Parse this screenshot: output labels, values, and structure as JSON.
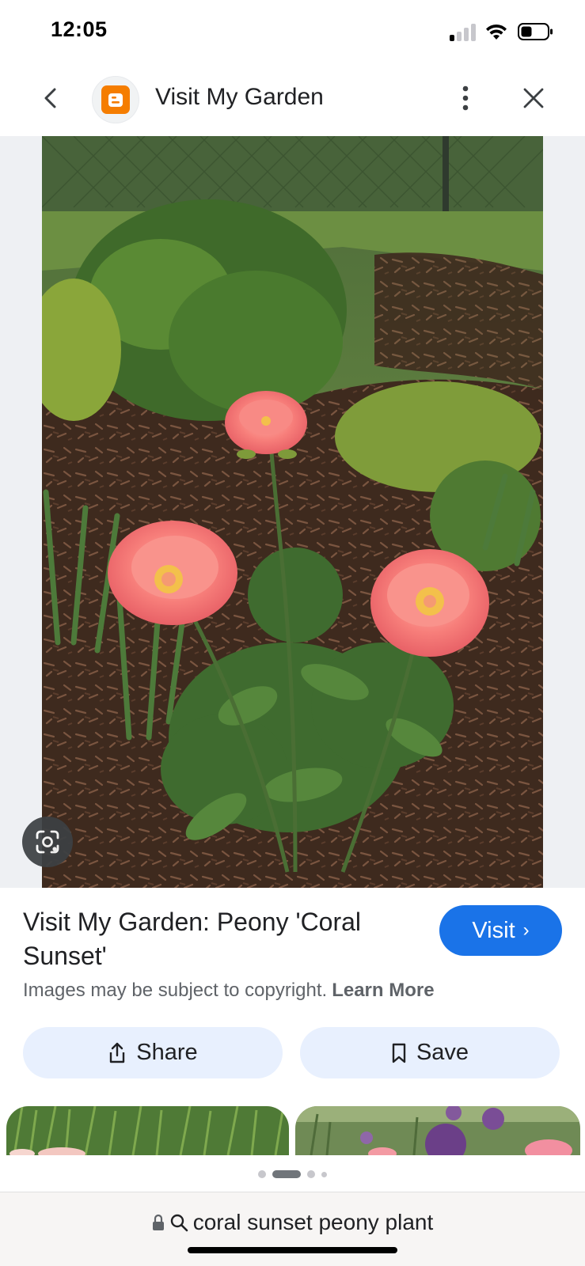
{
  "status_bar": {
    "time": "12:05",
    "icons": [
      "cellular-signal-icon",
      "wifi-icon",
      "battery-icon"
    ]
  },
  "header": {
    "site_logo_icon": "blogger-icon",
    "title": "Visit My Garden",
    "back_icon": "chevron-left-icon",
    "more_icon": "more-vertical-icon",
    "close_icon": "close-icon"
  },
  "image": {
    "lens_icon": "google-lens-icon"
  },
  "info": {
    "title": "Visit My Garden: Peony 'Coral Sunset'",
    "visit_label": "Visit",
    "visit_icon": "chevron-right-icon",
    "copyright_text": "Images may be subject to copyright.",
    "learn_more": "Learn More"
  },
  "actions": {
    "share_label": "Share",
    "share_icon": "share-icon",
    "save_label": "Save",
    "save_icon": "bookmark-icon"
  },
  "pager": {
    "count": 4,
    "active_index": 1
  },
  "address_bar": {
    "lock_icon": "lock-icon",
    "search_icon": "search-icon",
    "query": "coral sunset peony plant"
  },
  "colors": {
    "accent": "#1a73e8",
    "tonal_button": "#e8f0fe",
    "blogger_orange": "#f57d00"
  }
}
